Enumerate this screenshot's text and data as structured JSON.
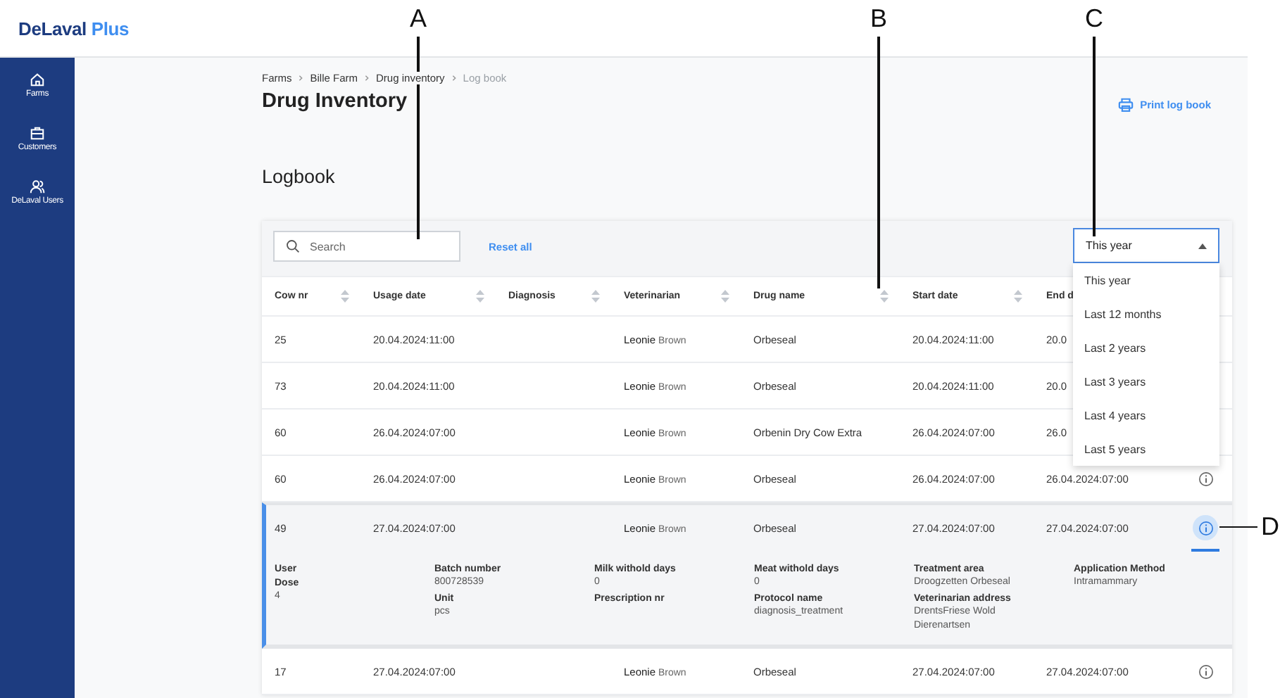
{
  "brand": {
    "name": "DeLaval",
    "suffix": "Plus"
  },
  "sidebar": {
    "items": [
      {
        "label": "Farms"
      },
      {
        "label": "Customers"
      },
      {
        "label": "DeLaval Users"
      }
    ]
  },
  "breadcrumb": [
    {
      "label": "Farms",
      "current": false
    },
    {
      "label": "Bille Farm",
      "current": false
    },
    {
      "label": "Drug inventory",
      "current": false
    },
    {
      "label": "Log book",
      "current": true
    }
  ],
  "page_title": "Drug Inventory",
  "print_link": "Print log book",
  "section_title": "Logbook",
  "toolbar": {
    "search": {
      "placeholder": "Search"
    },
    "reset": "Reset all",
    "range": {
      "value": "This year",
      "expanded": true,
      "options": [
        "This year",
        "Last 12 months",
        "Last 2 years",
        "Last 3 years",
        "Last 4 years",
        "Last 5 years"
      ]
    }
  },
  "table": {
    "columns": [
      {
        "label": "Cow nr",
        "sortable": true
      },
      {
        "label": "Usage date",
        "sortable": true
      },
      {
        "label": "Diagnosis",
        "sortable": true
      },
      {
        "label": "Veterinarian",
        "sortable": true
      },
      {
        "label": "Drug name",
        "sortable": true
      },
      {
        "label": "Start date",
        "sortable": true
      },
      {
        "label": "End d"
      }
    ],
    "rows": [
      {
        "cow_nr": "25",
        "usage_date": "20.04.2024:11:00",
        "veterinarian": "**Leonie** Brown",
        "drug_name": "Orbeseal",
        "start_date": "20.04.2024:11:00",
        "end_date": "20.0",
        "expanded": false
      },
      {
        "cow_nr": "73",
        "usage_date": "20.04.2024:11:00",
        "veterinarian": "**Leonie** Brown",
        "drug_name": "Orbeseal",
        "start_date": "20.04.2024:11:00",
        "end_date": "20.0",
        "expanded": false
      },
      {
        "cow_nr": "60",
        "usage_date": "26.04.2024:07:00",
        "veterinarian": "**Leonie** Brown",
        "drug_name": "Orbenin Dry Cow Extra",
        "start_date": "26.04.2024:07:00",
        "end_date": "26.0",
        "expanded": false
      },
      {
        "cow_nr": "60",
        "usage_date": "26.04.2024:07:00",
        "veterinarian": "**Leonie** Brown",
        "drug_name": "Orbeseal",
        "start_date": "26.04.2024:07:00",
        "end_date": "26.04.2024:07:00",
        "info": true,
        "expanded": false
      },
      {
        "cow_nr": "49",
        "usage_date": "27.04.2024:07:00",
        "veterinarian": "**Leonie** Brown",
        "drug_name": "Orbeseal",
        "start_date": "27.04.2024:07:00",
        "end_date": "27.04.2024:07:00",
        "info": true,
        "expanded": true,
        "details": [
          [
            {
              "label": "User"
            },
            {
              "label": "Dose",
              "value": "4"
            }
          ],
          [
            {
              "label": "Batch number",
              "value": "800728539"
            },
            {
              "label": "Unit",
              "value": "pcs"
            }
          ],
          [
            {
              "label": "Milk withold days",
              "value": "0"
            },
            {
              "label": "Prescription nr"
            }
          ],
          [
            {
              "label": "Meat withold days",
              "value": "0"
            },
            {
              "label": "Protocol name",
              "value": "diagnosis_treatment"
            }
          ],
          [
            {
              "label": "Treatment area",
              "value": "Droogzetten Orbeseal"
            },
            {
              "label": "Veterinarian address",
              "value": "DrentsFriese Wold Dierenartsen"
            }
          ],
          [
            {
              "label": "Application Method",
              "value": "Intramammary"
            }
          ]
        ]
      },
      {
        "cow_nr": "17",
        "usage_date": "27.04.2024:07:00",
        "veterinarian": "**Leonie** Brown",
        "drug_name": "Orbeseal",
        "start_date": "27.04.2024:07:00",
        "end_date": "27.04.2024:07:00",
        "info": true,
        "expanded": false
      }
    ]
  },
  "callouts": [
    {
      "label": "A"
    },
    {
      "label": "B"
    },
    {
      "label": "C"
    },
    {
      "label": "D"
    }
  ]
}
